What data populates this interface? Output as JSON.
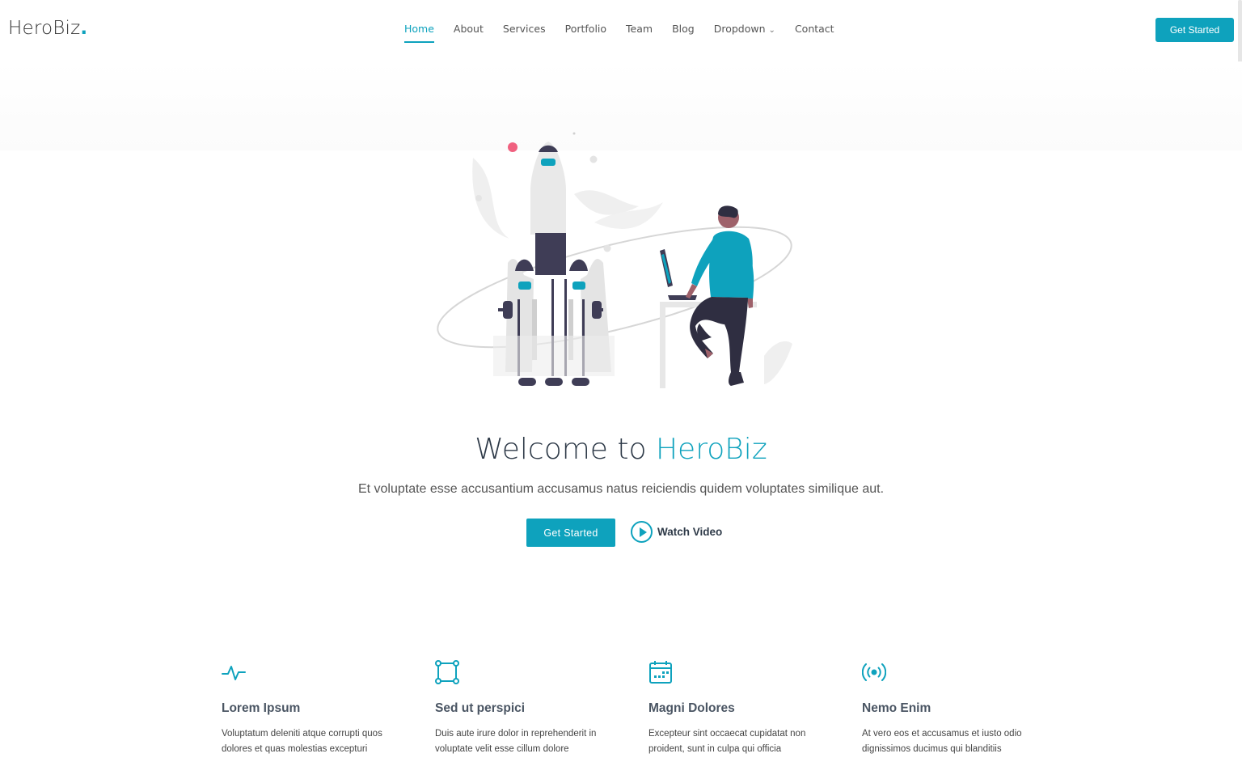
{
  "brand": {
    "name": "HeroBiz",
    "dot": ".",
    "accent_color": "#0ea2bd"
  },
  "nav": {
    "items": [
      {
        "label": "Home",
        "active": true
      },
      {
        "label": "About"
      },
      {
        "label": "Services"
      },
      {
        "label": "Portfolio"
      },
      {
        "label": "Team"
      },
      {
        "label": "Blog"
      },
      {
        "label": "Dropdown",
        "has_dropdown": true
      },
      {
        "label": "Contact"
      }
    ],
    "cta_label": "Get Started"
  },
  "hero": {
    "title_prefix": "Welcome to ",
    "title_accent": "HeroBiz",
    "subtitle": "Et voluptate esse accusantium accusamus natus reiciendis quidem voluptates similique aut.",
    "primary_button": "Get Started",
    "video_link": "Watch Video"
  },
  "features": [
    {
      "icon": "activity-icon",
      "title": "Lorem Ipsum",
      "text": "Voluptatum deleniti atque corrupti quos dolores et quas molestias excepturi"
    },
    {
      "icon": "bounding-box-icon",
      "title": "Sed ut perspici",
      "text": "Duis aute irure dolor in reprehenderit in voluptate velit esse cillum dolore"
    },
    {
      "icon": "calendar-icon",
      "title": "Magni Dolores",
      "text": "Excepteur sint occaecat cupidatat non proident, sunt in culpa qui officia"
    },
    {
      "icon": "broadcast-icon",
      "title": "Nemo Enim",
      "text": "At vero eos et accusamus et iusto odio dignissimos ducimus qui blanditiis"
    }
  ]
}
